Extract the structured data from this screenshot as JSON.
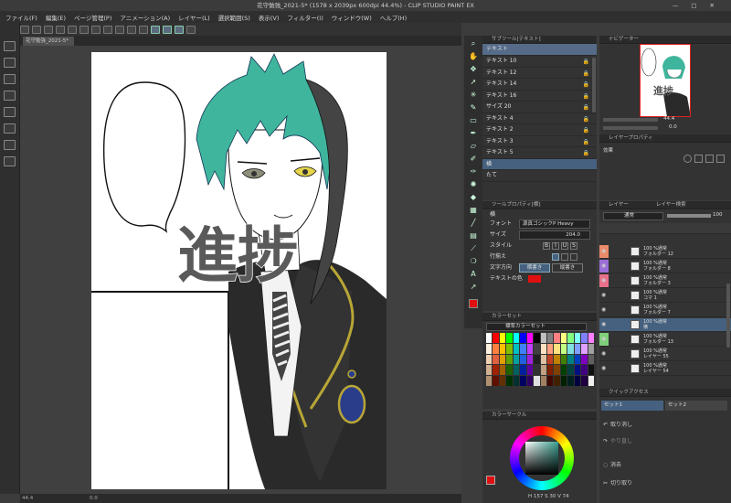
{
  "title": "花守勉強_2021-5* (1578 x 2039px 600dpi 44.4%) - CLIP STUDIO PAINT EX",
  "menu": [
    "ファイル(F)",
    "編集(E)",
    "ページ管理(P)",
    "アニメーション(A)",
    "レイヤー(L)",
    "選択範囲(S)",
    "表示(V)",
    "フィルター(I)",
    "ウィンドウ(W)",
    "ヘルプ(H)"
  ],
  "doc_tab": "花守勉強_2021-5* ×",
  "artwork_text": "進捗",
  "status": {
    "zoom": "44.4",
    "pos": "0.0"
  },
  "subtool": {
    "header": "サブツール[テキスト]",
    "tool": "テキスト",
    "items": [
      "テキスト 10",
      "テキスト 12",
      "テキスト 14",
      "テキスト 16",
      "サイズ 20",
      "テキスト 4",
      "テキスト 2",
      "テキスト 3",
      "テキスト 5",
      "横",
      "たて"
    ],
    "selected_index": 9
  },
  "toolprop": {
    "header": "ツールプロパティ[横]",
    "name": "横",
    "font_label": "フォント",
    "font_value": "源真ゴシックP Heavy",
    "size_label": "サイズ",
    "size_value": "204.0",
    "style_label": "スタイル",
    "align_label": "行揃え",
    "dir_label": "文字方向",
    "dir_value": "横書き",
    "dir_value2": "縦書き",
    "color_label": "テキストの色"
  },
  "colorset": {
    "header": "カラーセット",
    "set_name": "標準カラーセット"
  },
  "colorwheel": {
    "header": "カラーサークル",
    "readout": "H 157  S 30  V 74"
  },
  "navigator": {
    "header": "ナビゲーター",
    "zoom": "44.4",
    "angle": "0.0"
  },
  "layerprop": {
    "header": "レイヤープロパティ",
    "effect_label": "効果"
  },
  "layer": {
    "header": "レイヤー",
    "tab2": "レイヤー検索",
    "blend": "通常",
    "opacity": "100",
    "rows": [
      {
        "l1": "100 %通常",
        "l2": "フォルダー 12",
        "color": "#e98a6a"
      },
      {
        "l1": "100 %通常",
        "l2": "フォルダー 8",
        "color": "#9a6ed6"
      },
      {
        "l1": "100 %通常",
        "l2": "フォルダー 3",
        "color": "#e8708a"
      },
      {
        "l1": "100 %通常",
        "l2": "コマ 1",
        "color": ""
      },
      {
        "l1": "100 %通常",
        "l2": "フォルダー 7",
        "color": ""
      },
      {
        "l1": "100 %通常",
        "l2": "横",
        "color": ""
      },
      {
        "l1": "100 %通常",
        "l2": "フォルダー 13",
        "color": "#7fd07a"
      },
      {
        "l1": "100 %通常",
        "l2": "レイヤー 55",
        "color": ""
      },
      {
        "l1": "100 %通常",
        "l2": "レイヤー 54",
        "color": ""
      }
    ]
  },
  "quick": {
    "header": "クイックアクセス",
    "tab1": "セット1",
    "tab2": "セット2",
    "items": [
      "取り消し",
      "やり直し",
      "消去",
      "切り取り"
    ]
  },
  "colors": {
    "accent": "#46617f",
    "main_color": "#e01010"
  }
}
